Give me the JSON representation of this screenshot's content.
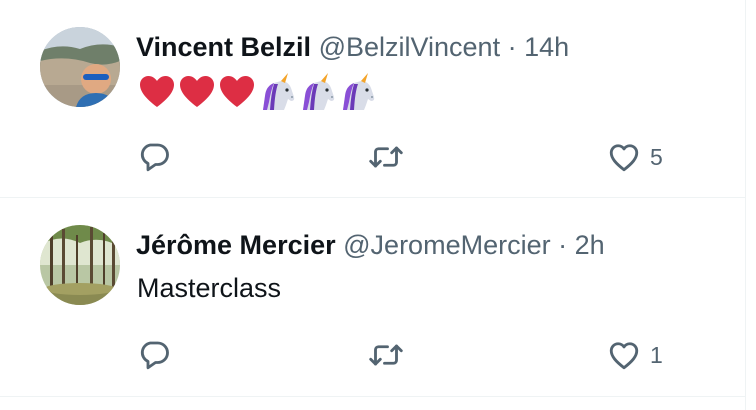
{
  "tweets": [
    {
      "display_name": "Vincent Belzil",
      "handle": "@BelzilVincent",
      "separator": "·",
      "time": "14h",
      "text": "",
      "emoji": [
        "red-heart",
        "red-heart",
        "red-heart",
        "unicorn",
        "unicorn",
        "unicorn"
      ],
      "reply_count": "",
      "retweet_count": "",
      "like_count": "5"
    },
    {
      "display_name": "Jérôme Mercier",
      "handle": "@JeromeMercier",
      "separator": "·",
      "time": "2h",
      "text": "Masterclass",
      "emoji": [],
      "reply_count": "",
      "retweet_count": "",
      "like_count": "1"
    }
  ],
  "icons": {
    "reply": "reply-bubble-icon",
    "retweet": "retweet-arrows-icon",
    "like": "heart-outline-icon"
  },
  "colors": {
    "text_primary": "#0f1419",
    "text_secondary": "#536471",
    "divider": "#eff3f4",
    "heart_red": "#dd2e44"
  }
}
